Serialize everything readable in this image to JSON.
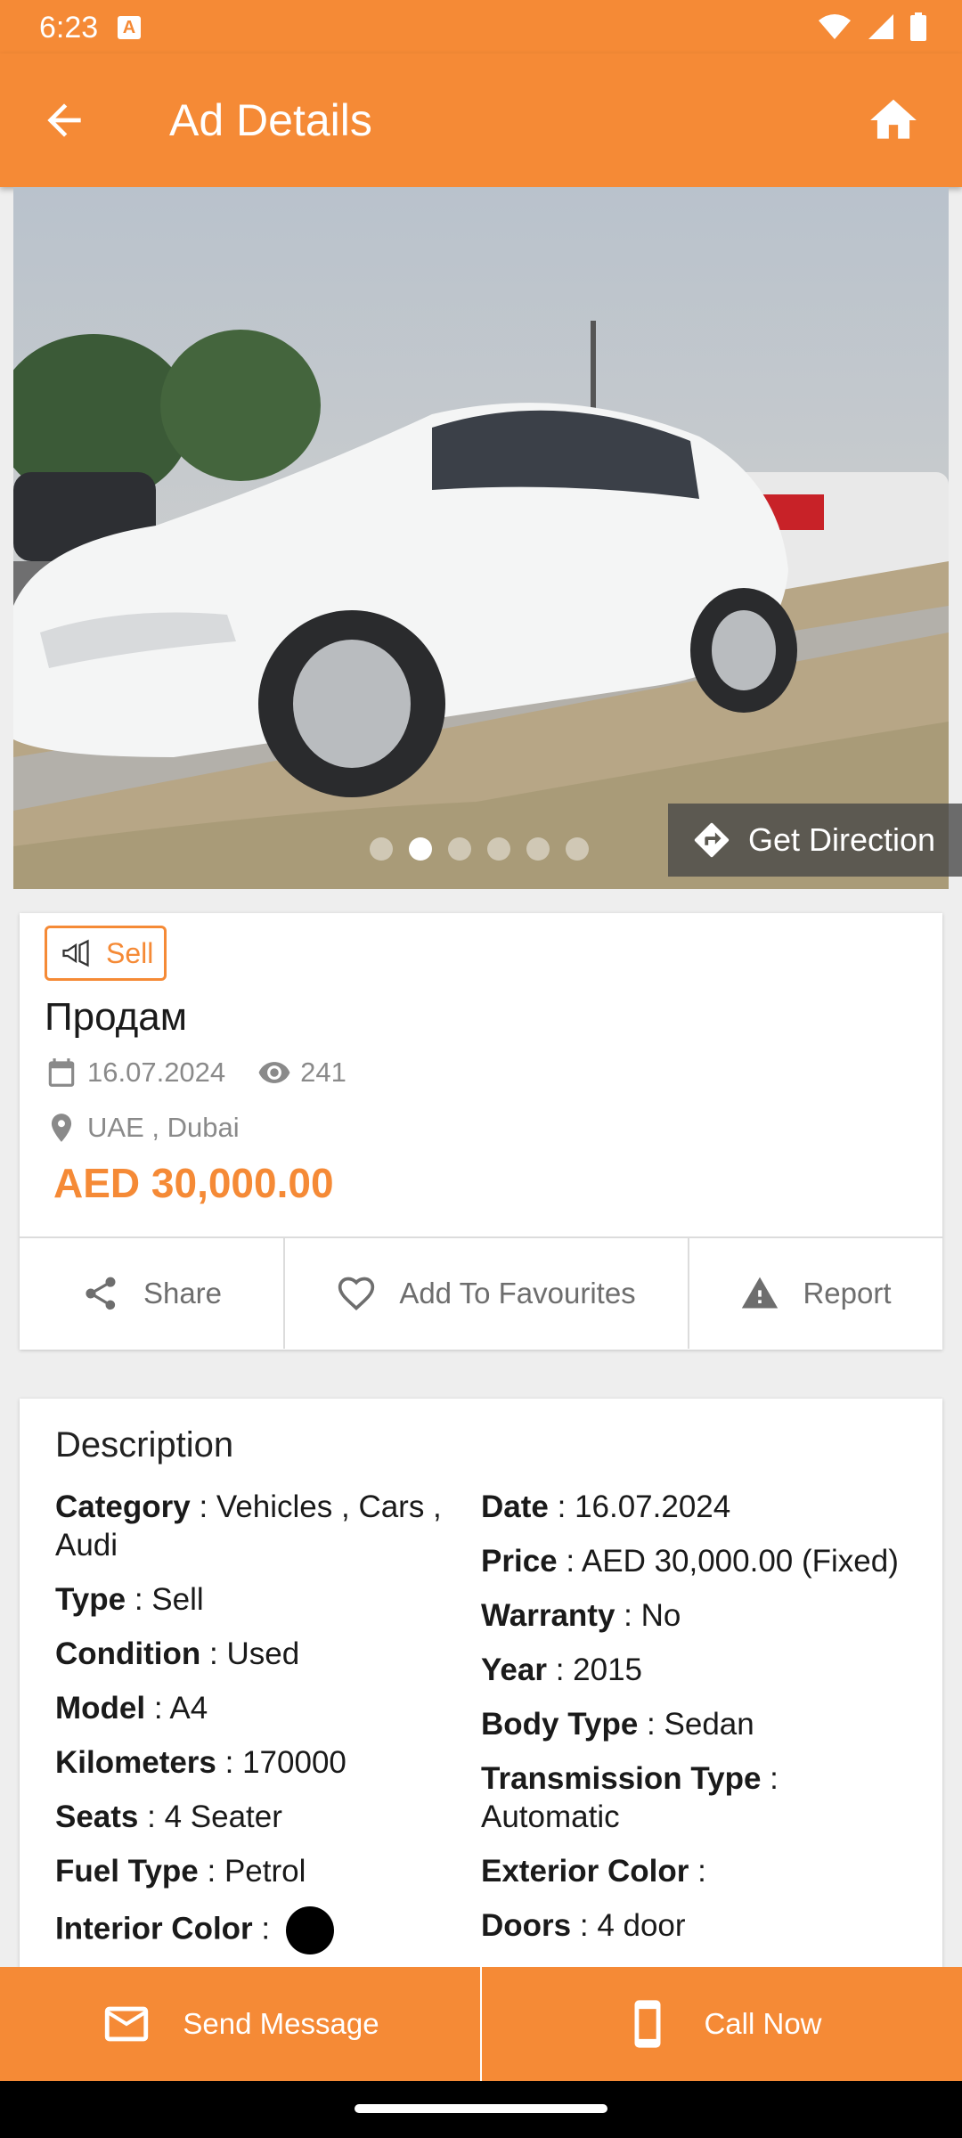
{
  "status_bar": {
    "time": "6:23"
  },
  "app_bar": {
    "title": "Ad Details"
  },
  "gallery": {
    "image_count": 6,
    "active_index": 1,
    "direction_label": "Get Direction"
  },
  "ad": {
    "badge": "Sell",
    "title": "Продам",
    "date": "16.07.2024",
    "views": "241",
    "location": "UAE , Dubai",
    "price": "AED 30,000.00"
  },
  "actions": {
    "share": "Share",
    "favourite": "Add To Favourites",
    "report": "Report"
  },
  "description": {
    "title": "Description",
    "left": [
      {
        "label": "Category",
        "value": "Vehicles , Cars , Audi"
      },
      {
        "label": "Type",
        "value": "Sell"
      },
      {
        "label": "Condition",
        "value": "Used"
      },
      {
        "label": "Model",
        "value": "A4"
      },
      {
        "label": "Kilometers",
        "value": "170000"
      },
      {
        "label": "Seats",
        "value": "4 Seater"
      },
      {
        "label": "Fuel Type",
        "value": "Petrol"
      },
      {
        "label": "Interior Color",
        "value": ""
      }
    ],
    "right": [
      {
        "label": "Date",
        "value": "16.07.2024"
      },
      {
        "label": "Price",
        "value": "AED 30,000.00 (Fixed)"
      },
      {
        "label": "Warranty",
        "value": "No"
      },
      {
        "label": "Year",
        "value": "2015"
      },
      {
        "label": "Body Type",
        "value": "Sedan"
      },
      {
        "label": "Transmission Type",
        "value": "Automatic"
      },
      {
        "label": "Exterior Color",
        "value": ""
      },
      {
        "label": "Doors",
        "value": "4 door"
      }
    ],
    "interior_color_swatch": "#000000"
  },
  "bottom_bar": {
    "message": "Send Message",
    "call": "Call Now"
  },
  "colors": {
    "accent": "#f58a36",
    "text_muted": "#8a8a8a"
  }
}
